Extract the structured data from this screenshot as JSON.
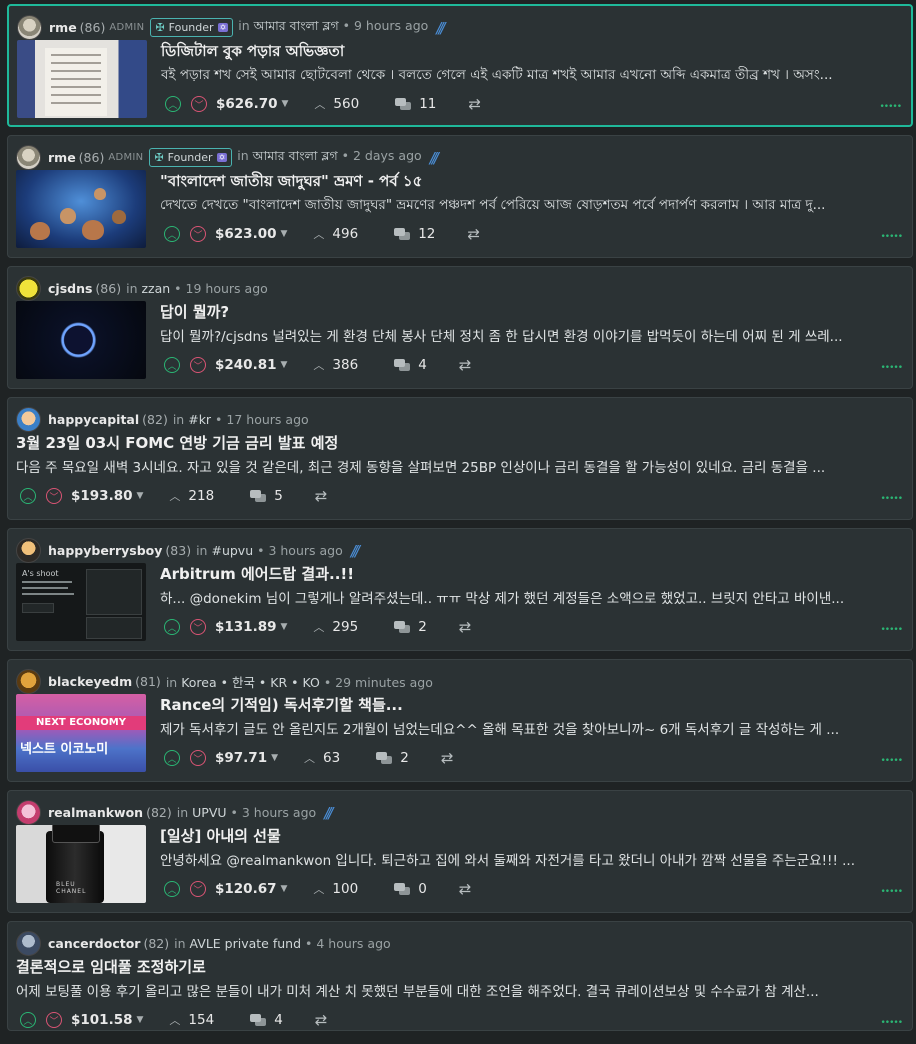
{
  "posts": [
    {
      "author": "rme",
      "rep": "(86)",
      "role": "ADMIN",
      "badge": "Founder",
      "in_label": "in",
      "community": "আমার বাংলা ব্লগ",
      "time": "9 hours ago",
      "title": "ডিজিটাল বুক পড়ার অভিজ্ঞতা",
      "excerpt": "বই পড়ার শখ সেই আমার ছোটবেলা থেকে । বলতে গেলে এই একটি মাত্র শখই আমার এখনো অব্দি একমাত্র তীব্র শখ । অসং...",
      "payout": "$626.70",
      "votes": "560",
      "comments": "11"
    },
    {
      "author": "rme",
      "rep": "(86)",
      "role": "ADMIN",
      "badge": "Founder",
      "in_label": "in",
      "community": "আমার বাংলা ব্লগ",
      "time": "2 days ago",
      "title": "\"বাংলাদেশ জাতীয় জাদুঘর\" ভ্রমণ - পর্ব ১৫",
      "excerpt": "দেখতে দেখতে \"বাংলাদেশ জাতীয় জাদুঘর\" ভ্রমণের পঞ্চদশ পর্ব পেরিয়ে আজ ষোড়শতম পর্বে পদার্পণ করলাম । আর মাত্র দু...",
      "payout": "$623.00",
      "votes": "496",
      "comments": "12"
    },
    {
      "author": "cjsdns",
      "rep": "(86)",
      "in_label": "in",
      "community": "zzan",
      "time": "19 hours ago",
      "title": "답이 뭘까?",
      "excerpt": "답이 뭘까?/cjsdns 널려있는 게 환경 단체 봉사 단체 정치 좀 한 답시면 환경 이야기를 밥먹듯이 하는데 어찌 된 게 쓰레...",
      "payout": "$240.81",
      "votes": "386",
      "comments": "4"
    },
    {
      "author": "happycapital",
      "rep": "(82)",
      "in_label": "in",
      "community": "#kr",
      "time": "17 hours ago",
      "title": "3월 23일 03시 FOMC 연방 기금 금리 발표 예정",
      "excerpt": "다음 주 목요일 새벽 3시네요. 자고 있을 것 같은데, 최근 경제 동향을 살펴보면 25BP 인상이나 금리 동결을 할 가능성이 있네요. 금리 동결을 ...",
      "payout": "$193.80",
      "votes": "218",
      "comments": "5"
    },
    {
      "author": "happyberrysboy",
      "rep": "(83)",
      "in_label": "in",
      "community": "#upvu",
      "time": "3 hours ago",
      "title": "Arbitrum 에어드랍 결과..!!",
      "excerpt": "하... @donekim 님이 그렇게나 알려주셨는데.. ㅠㅠ 막상 제가 했던 계정들은 소액으로 했었고.. 브릿지 안타고 바이낸...",
      "payout": "$131.89",
      "votes": "295",
      "comments": "2",
      "thumb_text": "A's shoot"
    },
    {
      "author": "blackeyedm",
      "rep": "(81)",
      "in_label": "in",
      "community": "Korea • 한국 • KR • KO",
      "time": "29 minutes ago",
      "title": "Rance의 기적임) 독서후기할 책들...",
      "excerpt": "제가 독서후기 글도 안 올린지도 2개월이 넘었는데요^^ 올해 목표한 것을 찾아보니까~ 6개 독서후기 글 작성하는 게 ...",
      "payout": "$97.71",
      "votes": "63",
      "comments": "2",
      "thumb_band": "NEXT ECONOMY",
      "thumb_kor": "넥스트 이코노미"
    },
    {
      "author": "realmankwon",
      "rep": "(82)",
      "in_label": "in",
      "community": "UPVU",
      "time": "3 hours ago",
      "title": "[일상] 아내의 선물",
      "excerpt": "안녕하세요 @realmankwon 입니다. 퇴근하고 집에 와서 둘째와 자전거를 타고 왔더니 아내가 깜짝 선물을 주는군요!!! ...",
      "payout": "$120.67",
      "votes": "100",
      "comments": "0",
      "thumb_label": "BLEU CHANEL"
    },
    {
      "author": "cancerdoctor",
      "rep": "(82)",
      "in_label": "in",
      "community": "AVLE private fund",
      "time": "4 hours ago",
      "title": "결론적으로 임대풀 조정하기로",
      "excerpt": "어제 보팅풀 이용 후기 올리고 많은 분들이 내가 미처 계산 치 못했던 부분들에 대한 조언을 해주었다. 결국 큐레이션보상 및 수수료가 참 계산...",
      "payout": "$101.58",
      "votes": "154",
      "comments": "4"
    }
  ],
  "icons": {
    "upvote": "upvote-icon",
    "downvote": "downvote-icon",
    "voters": "chevron-up-icon",
    "comments": "comments-icon",
    "resteem": "resteem-icon",
    "caret": "caret-down-icon",
    "steem": "steem-logo-icon"
  },
  "colors": {
    "upvote": "#2bb574",
    "downvote": "#d95474",
    "highlight": "#1fb99a",
    "background": "#1f2324",
    "card": "#2b3234"
  }
}
